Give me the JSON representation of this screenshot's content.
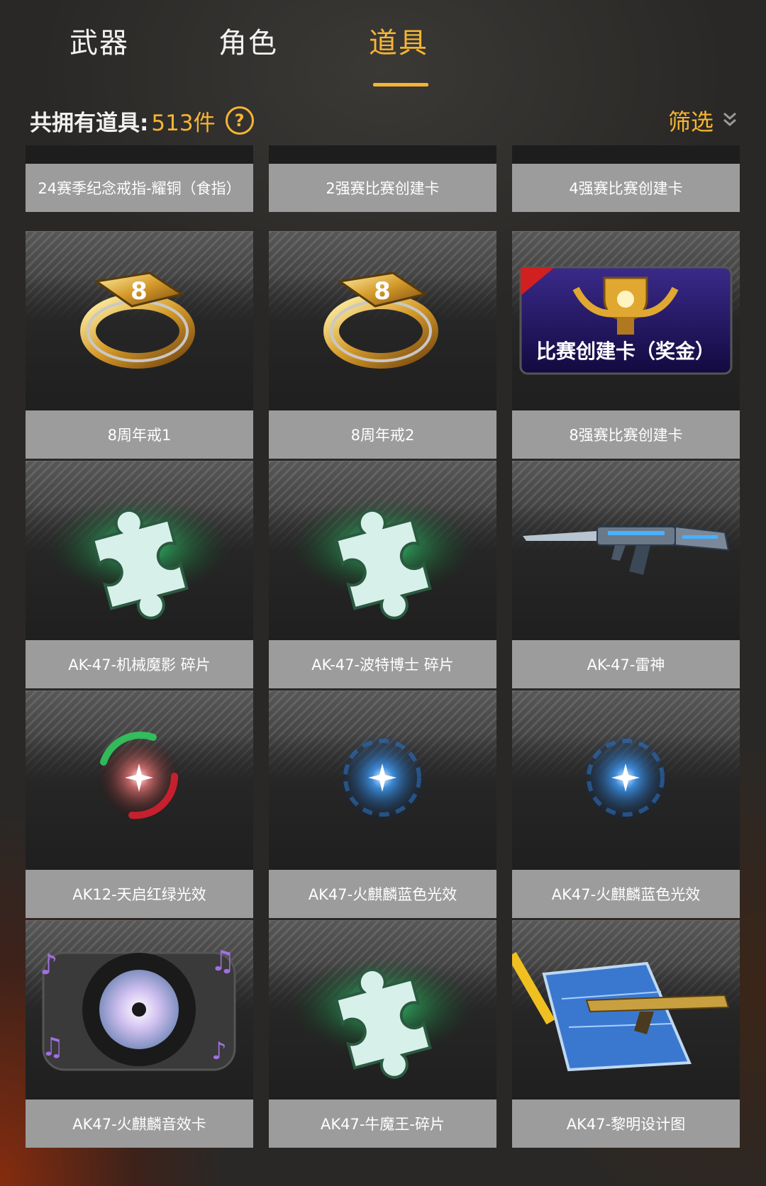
{
  "tabs": [
    {
      "label": "武器",
      "active": false
    },
    {
      "label": "角色",
      "active": false
    },
    {
      "label": "道具",
      "active": true
    }
  ],
  "summary": {
    "label": "共拥有道具:",
    "count": "513件",
    "help": "?"
  },
  "filter": {
    "label": "筛选"
  },
  "colors": {
    "accent": "#f6b533",
    "label_bg": "#9c9c9c",
    "text": "#ffffff"
  },
  "items_partial": [
    {
      "name": "24赛季纪念戒指-耀铜（食指）"
    },
    {
      "name": "2强赛比赛创建卡"
    },
    {
      "name": "4强赛比赛创建卡"
    }
  ],
  "items": [
    {
      "name": "8周年戒1",
      "icon": "ring-icon"
    },
    {
      "name": "8周年戒2",
      "icon": "ring-icon"
    },
    {
      "name": "8强赛比赛创建卡",
      "icon": "match-card-icon",
      "image_text": "比赛创建卡（奖金）"
    },
    {
      "name": "AK-47-机械魔影 碎片",
      "icon": "puzzle-fragment-icon"
    },
    {
      "name": "AK-47-波特博士 碎片",
      "icon": "puzzle-fragment-icon"
    },
    {
      "name": "AK-47-雷神",
      "icon": "rifle-icon"
    },
    {
      "name": "AK12-天启红绿光效",
      "icon": "red-green-glow-icon"
    },
    {
      "name": "AK47-火麒麟蓝色光效",
      "icon": "blue-glow-icon"
    },
    {
      "name": "AK47-火麒麟蓝色光效",
      "icon": "blue-glow-icon"
    },
    {
      "name": "AK47-火麒麟音效卡",
      "icon": "sound-disc-icon"
    },
    {
      "name": "AK47-牛魔王-碎片",
      "icon": "puzzle-fragment-icon"
    },
    {
      "name": "AK47-黎明设计图",
      "icon": "blueprint-icon"
    }
  ]
}
